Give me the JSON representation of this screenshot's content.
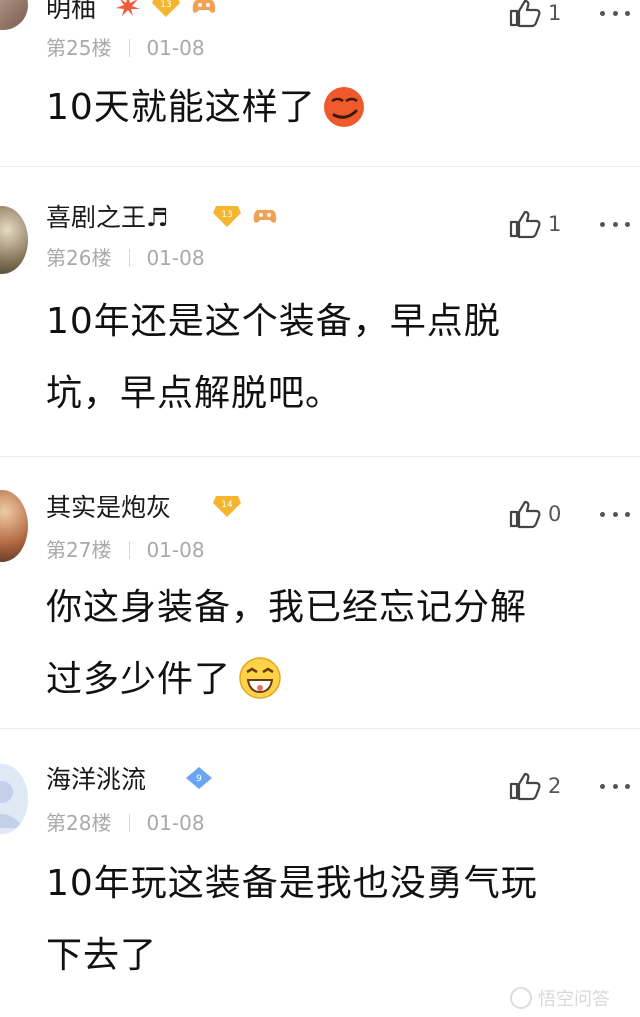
{
  "comments": [
    {
      "username": "明柚",
      "floor": "第25楼",
      "date": "01-08",
      "likes": "1",
      "level": "13",
      "text": "10天就能这样了"
    },
    {
      "username": "喜剧之王♬",
      "floor": "第26楼",
      "date": "01-08",
      "likes": "1",
      "level": "13",
      "text_line1": "10年还是这个装备，早点脱",
      "text_line2": "坑，早点解脱吧。"
    },
    {
      "username": "其实是炮灰",
      "floor": "第27楼",
      "date": "01-08",
      "likes": "0",
      "level": "14",
      "text_line1": "你这身装备，我已经忘记分解",
      "text_line2": "过多少件了"
    },
    {
      "username": "海洋洮流",
      "floor": "第28楼",
      "date": "01-08",
      "likes": "2",
      "level": "9",
      "text_line1": "10年玩这装备是我也没勇气玩",
      "text_line2": "下去了"
    }
  ],
  "watermark": "悟空问答",
  "colors": {
    "level_badge_gold": "#f5b52e",
    "level_badge_blue": "#6aa6f0",
    "meta_gray": "#a9a9a9"
  }
}
